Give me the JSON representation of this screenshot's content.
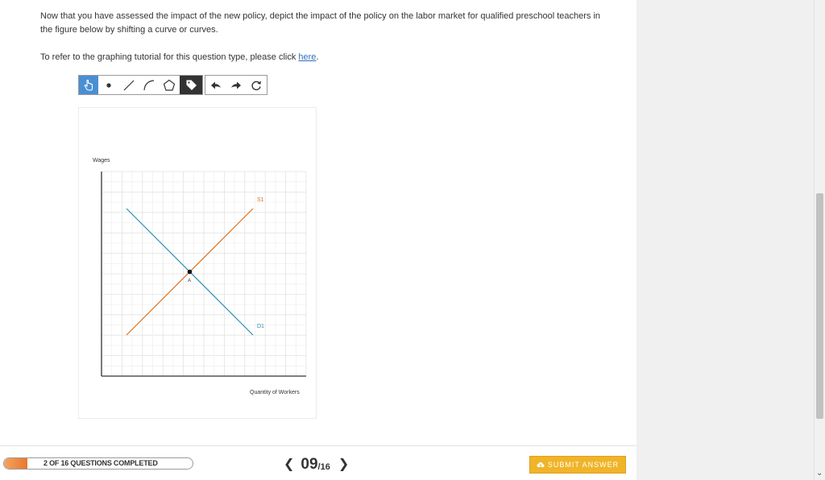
{
  "question": {
    "paragraph1": "Now that you have assessed the impact of the new policy, depict the impact of the policy on the labor market for qualified preschool teachers in the figure below by shifting a curve or curves.",
    "tutorial_prefix": "To refer to the graphing tutorial for this question type, please click ",
    "tutorial_link": "here",
    "tutorial_suffix": "."
  },
  "toolbar": {
    "draw_tools": [
      {
        "name": "pointer-tool",
        "icon": "hand-pointer-icon",
        "active": true
      },
      {
        "name": "point-tool",
        "icon": "point-icon"
      },
      {
        "name": "line-tool",
        "icon": "line-icon"
      },
      {
        "name": "curve-tool",
        "icon": "curve-icon"
      },
      {
        "name": "polygon-tool",
        "icon": "pentagon-icon"
      },
      {
        "name": "label-tool",
        "icon": "tag-icon",
        "dark": true
      }
    ],
    "history_tools": [
      {
        "name": "undo-tool",
        "icon": "undo-arrow-icon"
      },
      {
        "name": "redo-tool",
        "icon": "redo-arrow-icon"
      },
      {
        "name": "reset-tool",
        "icon": "reset-icon"
      }
    ]
  },
  "graph": {
    "y_axis_label": "Wages",
    "x_axis_label": "Quantity of Workers",
    "supply_label": "S1",
    "demand_label": "D1",
    "equilibrium_label": "A",
    "supply_color": "#e07020",
    "demand_color": "#2a8fb0",
    "grid_cells": 10
  },
  "footer": {
    "progress_text": "2 OF 16 QUESTIONS COMPLETED",
    "progress_fraction": 0.125,
    "page_current": "09",
    "page_total": "/16",
    "submit_label": "SUBMIT ANSWER",
    "submit_icon": "cloud-upload-icon",
    "accent_color": "#f0b429"
  }
}
